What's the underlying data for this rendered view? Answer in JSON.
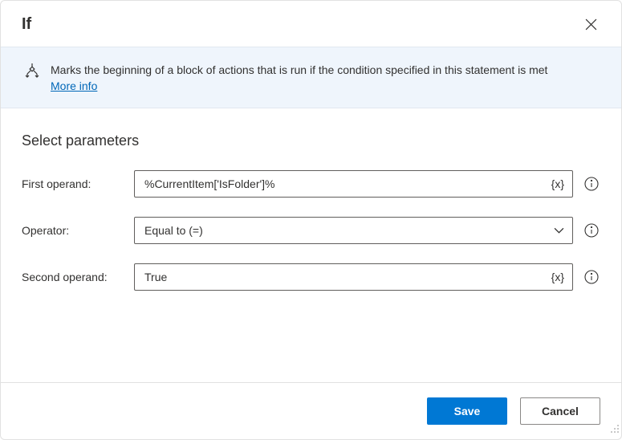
{
  "header": {
    "title": "If"
  },
  "banner": {
    "description": "Marks the beginning of a block of actions that is run if the condition specified in this statement is met",
    "moreInfoLabel": "More info"
  },
  "section": {
    "title": "Select parameters"
  },
  "params": {
    "firstOperand": {
      "label": "First operand:",
      "value": "%CurrentItem['IsFolder']%"
    },
    "operator": {
      "label": "Operator:",
      "value": "Equal to (=)"
    },
    "secondOperand": {
      "label": "Second operand:",
      "value": "True"
    }
  },
  "icons": {
    "varToken": "{x}"
  },
  "footer": {
    "save": "Save",
    "cancel": "Cancel"
  }
}
